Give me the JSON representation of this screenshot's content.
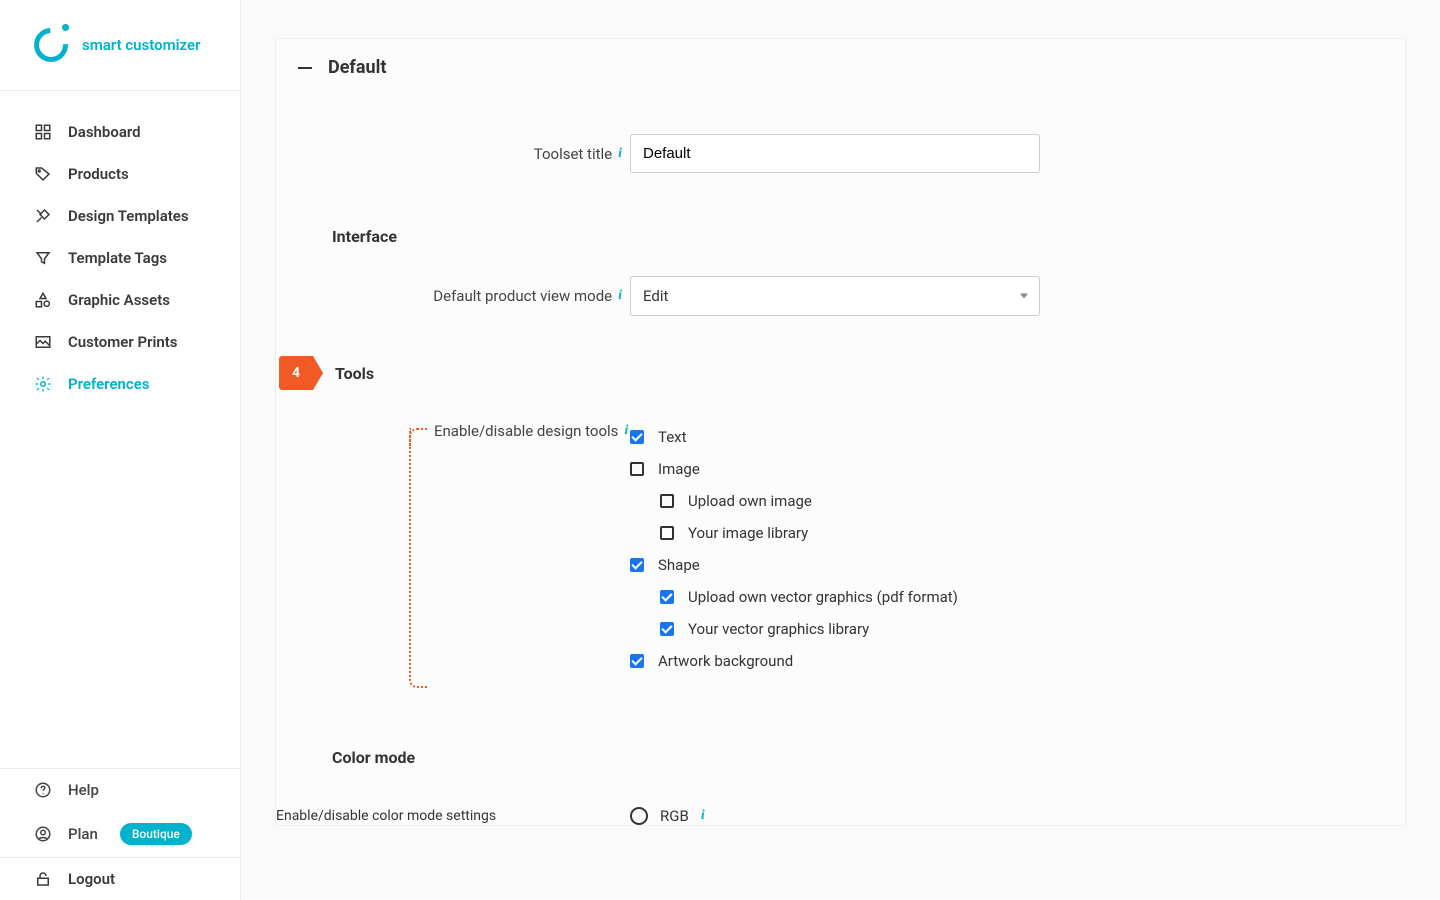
{
  "brand": {
    "name": "smart customizer"
  },
  "nav": {
    "dashboard": "Dashboard",
    "products": "Products",
    "designTemplates": "Design Templates",
    "templateTags": "Template Tags",
    "graphicAssets": "Graphic Assets",
    "customerPrints": "Customer Prints",
    "preferences": "Preferences",
    "help": "Help",
    "plan": "Plan",
    "planBadge": "Boutique",
    "logout": "Logout"
  },
  "panel": {
    "title": "Default",
    "toolsetTitleLabel": "Toolset title",
    "toolsetTitleValue": "Default",
    "interfaceHeader": "Interface",
    "productViewModeLabel": "Default product view mode",
    "productViewModeValue": "Edit",
    "toolsCalloutNumber": "4",
    "toolsHeader": "Tools",
    "designToolsLabel": "Enable/disable design tools",
    "tools": {
      "text": "Text",
      "image": "Image",
      "uploadOwnImage": "Upload own image",
      "imageLibrary": "Your image library",
      "shape": "Shape",
      "uploadVector": "Upload own vector graphics (pdf format)",
      "vectorLibrary": "Your vector graphics library",
      "artworkBg": "Artwork background"
    },
    "colorModeHeader": "Color mode",
    "colorModeLabel": "Enable/disable color mode settings",
    "colorModeOption": "RGB"
  }
}
